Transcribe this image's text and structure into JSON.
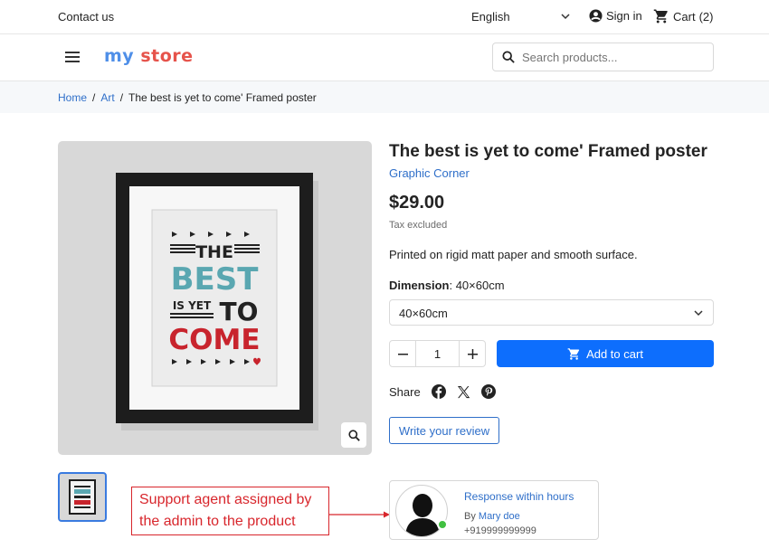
{
  "topbar": {
    "contact": "Contact us",
    "language": "English",
    "signin": "Sign in",
    "cart": "Cart",
    "cart_count": "(2)"
  },
  "header": {
    "logo_word1": "my",
    "logo_word2": "store",
    "search_placeholder": "Search products..."
  },
  "breadcrumb": {
    "items": [
      "Home",
      "Art",
      "The best is yet to come' Framed poster"
    ],
    "separator": "/"
  },
  "poster": {
    "line1": "THE",
    "line2": "BEST",
    "line3a": "IS YET",
    "line3b": "TO",
    "line4": "COME"
  },
  "product": {
    "title": "The best is yet to come' Framed poster",
    "brand": "Graphic Corner",
    "price": "$29.00",
    "tax_note": "Tax excluded",
    "description": "Printed on rigid matt paper and smooth surface.",
    "dimension_label": "Dimension",
    "dimension_value": "40×60cm",
    "dimension_selected": "40×60cm",
    "quantity": "1",
    "add_to_cart": "Add to cart",
    "share_label": "Share",
    "review_button": "Write your review"
  },
  "agent": {
    "headline": "Response within hours",
    "by_label": "By",
    "name": "Mary doe",
    "phone": "+919999999999"
  },
  "annotation": {
    "line1": "Support agent assigned by",
    "line2": "the admin to the product"
  },
  "colors": {
    "accent": "#0d6efd",
    "link": "#2f6fc9",
    "annotation": "#d8262c",
    "online": "#41c041",
    "poster_teal": "#5aa7b1",
    "poster_red": "#c8242d"
  },
  "icons": [
    "chevron-down-icon",
    "user-circle-icon",
    "cart-icon",
    "menu-icon",
    "search-icon",
    "zoom-icon",
    "facebook-icon",
    "x-icon",
    "pinterest-icon",
    "person-silhouette-icon"
  ]
}
